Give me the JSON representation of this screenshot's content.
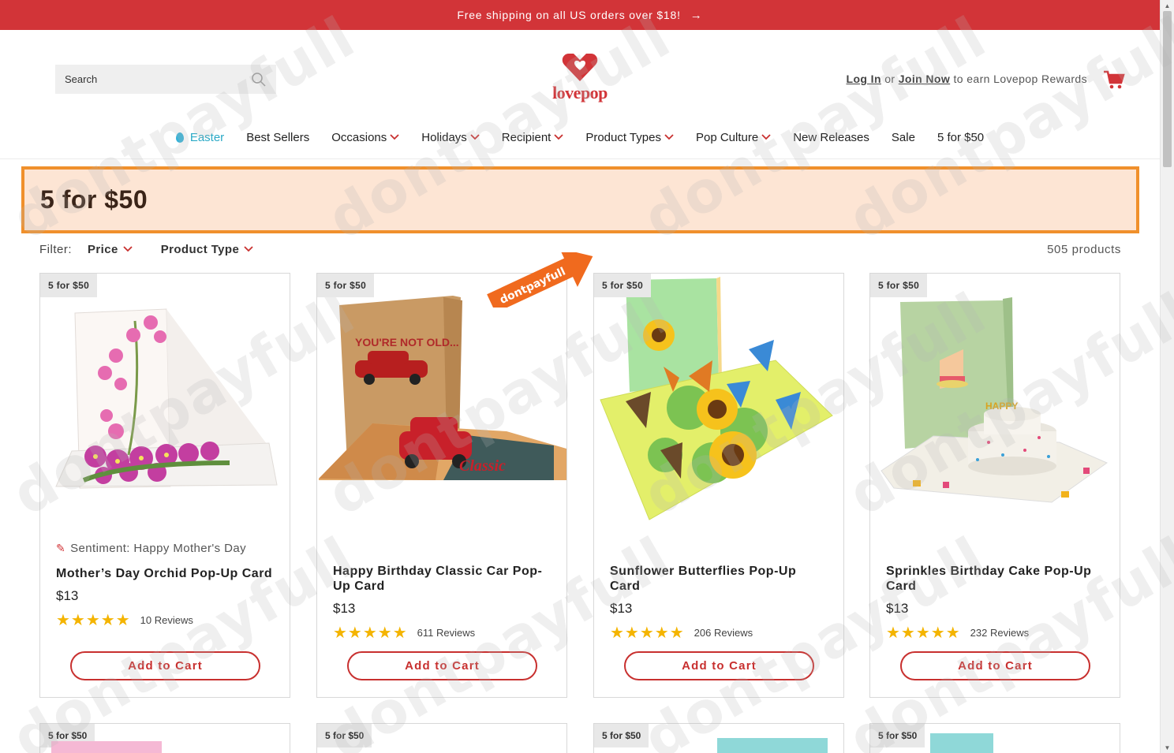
{
  "announcement": {
    "text": "Free shipping on all US orders over $18!",
    "arrow": "→"
  },
  "header": {
    "search_placeholder": "Search",
    "logo_text": "lovepop",
    "login_label": "Log In",
    "or_text": "or",
    "join_label": "Join Now",
    "rewards_text": "to earn Lovepop Rewards"
  },
  "nav": {
    "items": [
      {
        "label": "Easter"
      },
      {
        "label": "Best Sellers"
      },
      {
        "label": "Occasions"
      },
      {
        "label": "Holidays"
      },
      {
        "label": "Recipient"
      },
      {
        "label": "Product Types"
      },
      {
        "label": "Pop Culture"
      },
      {
        "label": "New Releases"
      },
      {
        "label": "Sale"
      },
      {
        "label": "5 for $50"
      }
    ]
  },
  "collection": {
    "title": "5 for $50"
  },
  "filter": {
    "label": "Filter:",
    "price_label": "Price",
    "type_label": "Product Type",
    "count": "505 products"
  },
  "products": [
    {
      "badge": "5 for $50",
      "sentiment": "Sentiment: Happy Mother's Day",
      "title": "Mother’s Day Orchid Pop-Up Card",
      "price": "$13",
      "reviews": "10 Reviews",
      "rating": 5,
      "button": "Add to Cart"
    },
    {
      "badge": "5 for $50",
      "title": "Happy Birthday Classic Car Pop-Up Card",
      "price": "$13",
      "reviews": "611 Reviews",
      "rating": 5,
      "button": "Add to Cart",
      "card_text": "YOU'RE NOT OLD..."
    },
    {
      "badge": "5 for $50",
      "title": "Sunflower Butterflies Pop-Up Card",
      "price": "$13",
      "reviews": "206 Reviews",
      "rating": 5,
      "button": "Add to Cart"
    },
    {
      "badge": "5 for $50",
      "title": "Sprinkles Birthday Cake Pop-Up Card",
      "price": "$13",
      "reviews": "232 Reviews",
      "rating": 5,
      "button": "Add to Cart"
    }
  ],
  "next_row_badges": [
    "5 for $50",
    "5 for $50",
    "5 for $50",
    "5 for $50"
  ],
  "watermark": "dontpayfull",
  "colors": {
    "brand_red": "#d23438",
    "banner_bg": "#fde5d4",
    "banner_border": "#f0902c",
    "star": "#f4b400",
    "easter": "#2aa9c6"
  }
}
